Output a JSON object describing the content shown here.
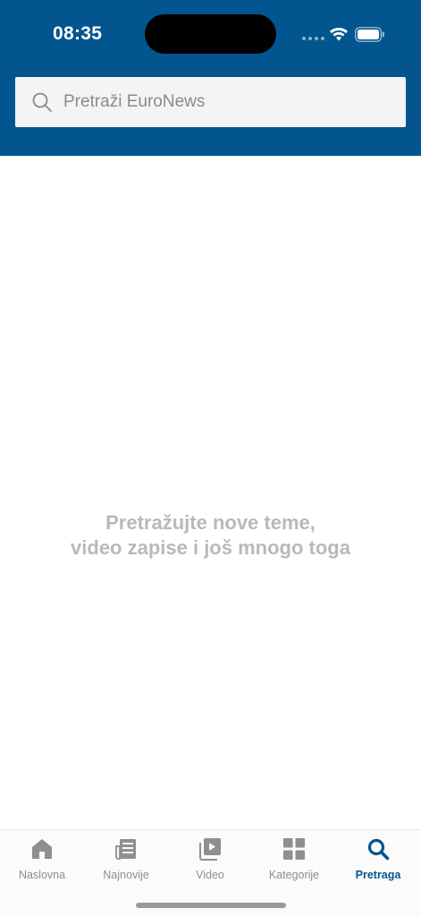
{
  "status_bar": {
    "time": "08:35"
  },
  "search": {
    "placeholder": "Pretraži EuroNews"
  },
  "empty_state": {
    "line1": "Pretražujte nove teme,",
    "line2": "video zapise i još mnogo toga"
  },
  "tabs": [
    {
      "label": "Naslovna",
      "icon": "home-icon"
    },
    {
      "label": "Najnovije",
      "icon": "newspaper-icon"
    },
    {
      "label": "Video",
      "icon": "video-icon"
    },
    {
      "label": "Kategorije",
      "icon": "grid-icon"
    },
    {
      "label": "Pretraga",
      "icon": "search-icon",
      "active": true
    }
  ],
  "colors": {
    "brand": "#03558f",
    "inactive": "#8e8e93",
    "empty_text": "#b8b9bc"
  }
}
